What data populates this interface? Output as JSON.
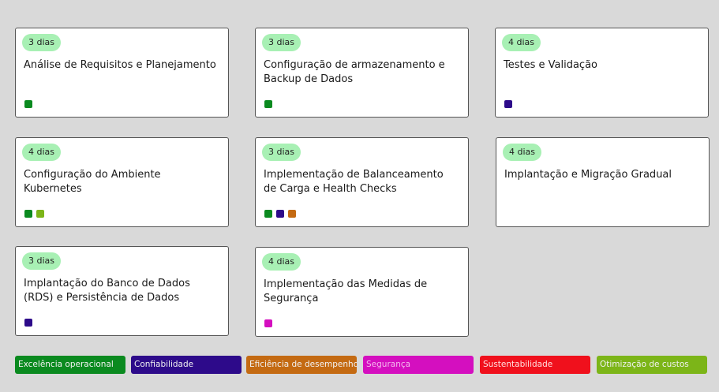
{
  "cards": [
    {
      "duration": "3 dias",
      "title": "Análise de Requisitos e Planejamento",
      "tags": [
        "#0a8a1f"
      ]
    },
    {
      "duration": "3 dias",
      "title": "Configuração de armazenamento e Backup de Dados",
      "tags": [
        "#0a8a1f"
      ]
    },
    {
      "duration": "4 dias",
      "title": "Testes e Validação",
      "tags": [
        "#2d0a8a"
      ]
    },
    {
      "duration": "4 dias",
      "title": "Configuração do Ambiente Kubernetes",
      "tags": [
        "#0a8a1f",
        "#7cb518"
      ]
    },
    {
      "duration": "3 dias",
      "title": "Implementação de Balanceamento de Carga e Health Checks",
      "tags": [
        "#0a8a1f",
        "#2d0a8a",
        "#c46a12"
      ]
    },
    {
      "duration": "4 dias",
      "title": "Implantação e Migração Gradual",
      "tags": []
    },
    {
      "duration": "3 dias",
      "title": "Implantação do Banco de Dados (RDS) e Persistência de Dados",
      "tags": [
        "#2d0a8a"
      ]
    },
    {
      "duration": "4 dias",
      "title": "Implementação das Medidas de Segurança",
      "tags": [
        "#d40fbf"
      ]
    }
  ],
  "legend": [
    {
      "label": "Excelência operacional",
      "color": "#0a8a1f"
    },
    {
      "label": "Confiabilidade",
      "color": "#2d0a8a"
    },
    {
      "label": "Eficiência de desempenho",
      "color": "#c46a12"
    },
    {
      "label": "Segurança",
      "color": "#d40fbf"
    },
    {
      "label": "Sustentabilidade",
      "color": "#f0101c"
    },
    {
      "label": "Otimização de custos",
      "color": "#7cb518"
    }
  ]
}
